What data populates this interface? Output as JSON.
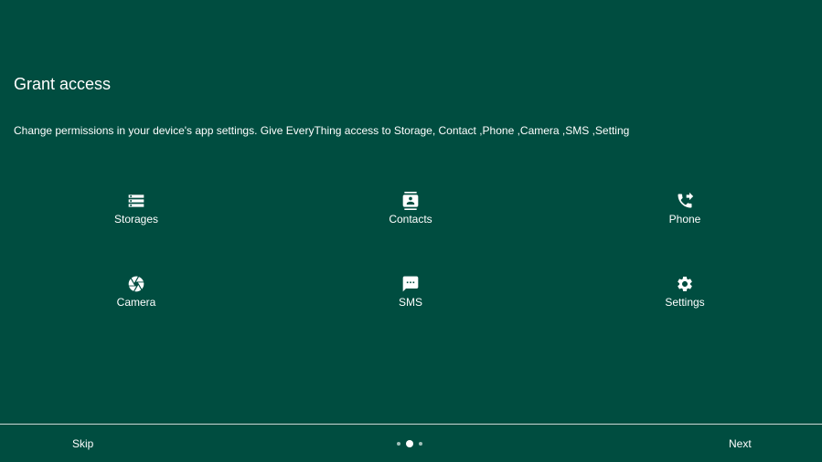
{
  "header": {
    "title": "Grant access",
    "description": "Change permissions in your device's app settings. Give EveryThing access to Storage, Contact ,Phone ,Camera ,SMS ,Setting"
  },
  "permissions": [
    {
      "label": "Storages",
      "icon": "storage-icon"
    },
    {
      "label": "Contacts",
      "icon": "contacts-icon"
    },
    {
      "label": "Phone",
      "icon": "phone-forward-icon"
    },
    {
      "label": "Camera",
      "icon": "camera-shutter-icon"
    },
    {
      "label": "SMS",
      "icon": "sms-icon"
    },
    {
      "label": "Settings",
      "icon": "gear-icon"
    }
  ],
  "footer": {
    "skip_label": "Skip",
    "next_label": "Next",
    "page_indicator": {
      "total": 3,
      "current": 2
    }
  },
  "colors": {
    "background": "#004d40",
    "text": "#ffffff",
    "divider": "#cfd8d6",
    "dot_inactive": "#9fbfb8"
  }
}
